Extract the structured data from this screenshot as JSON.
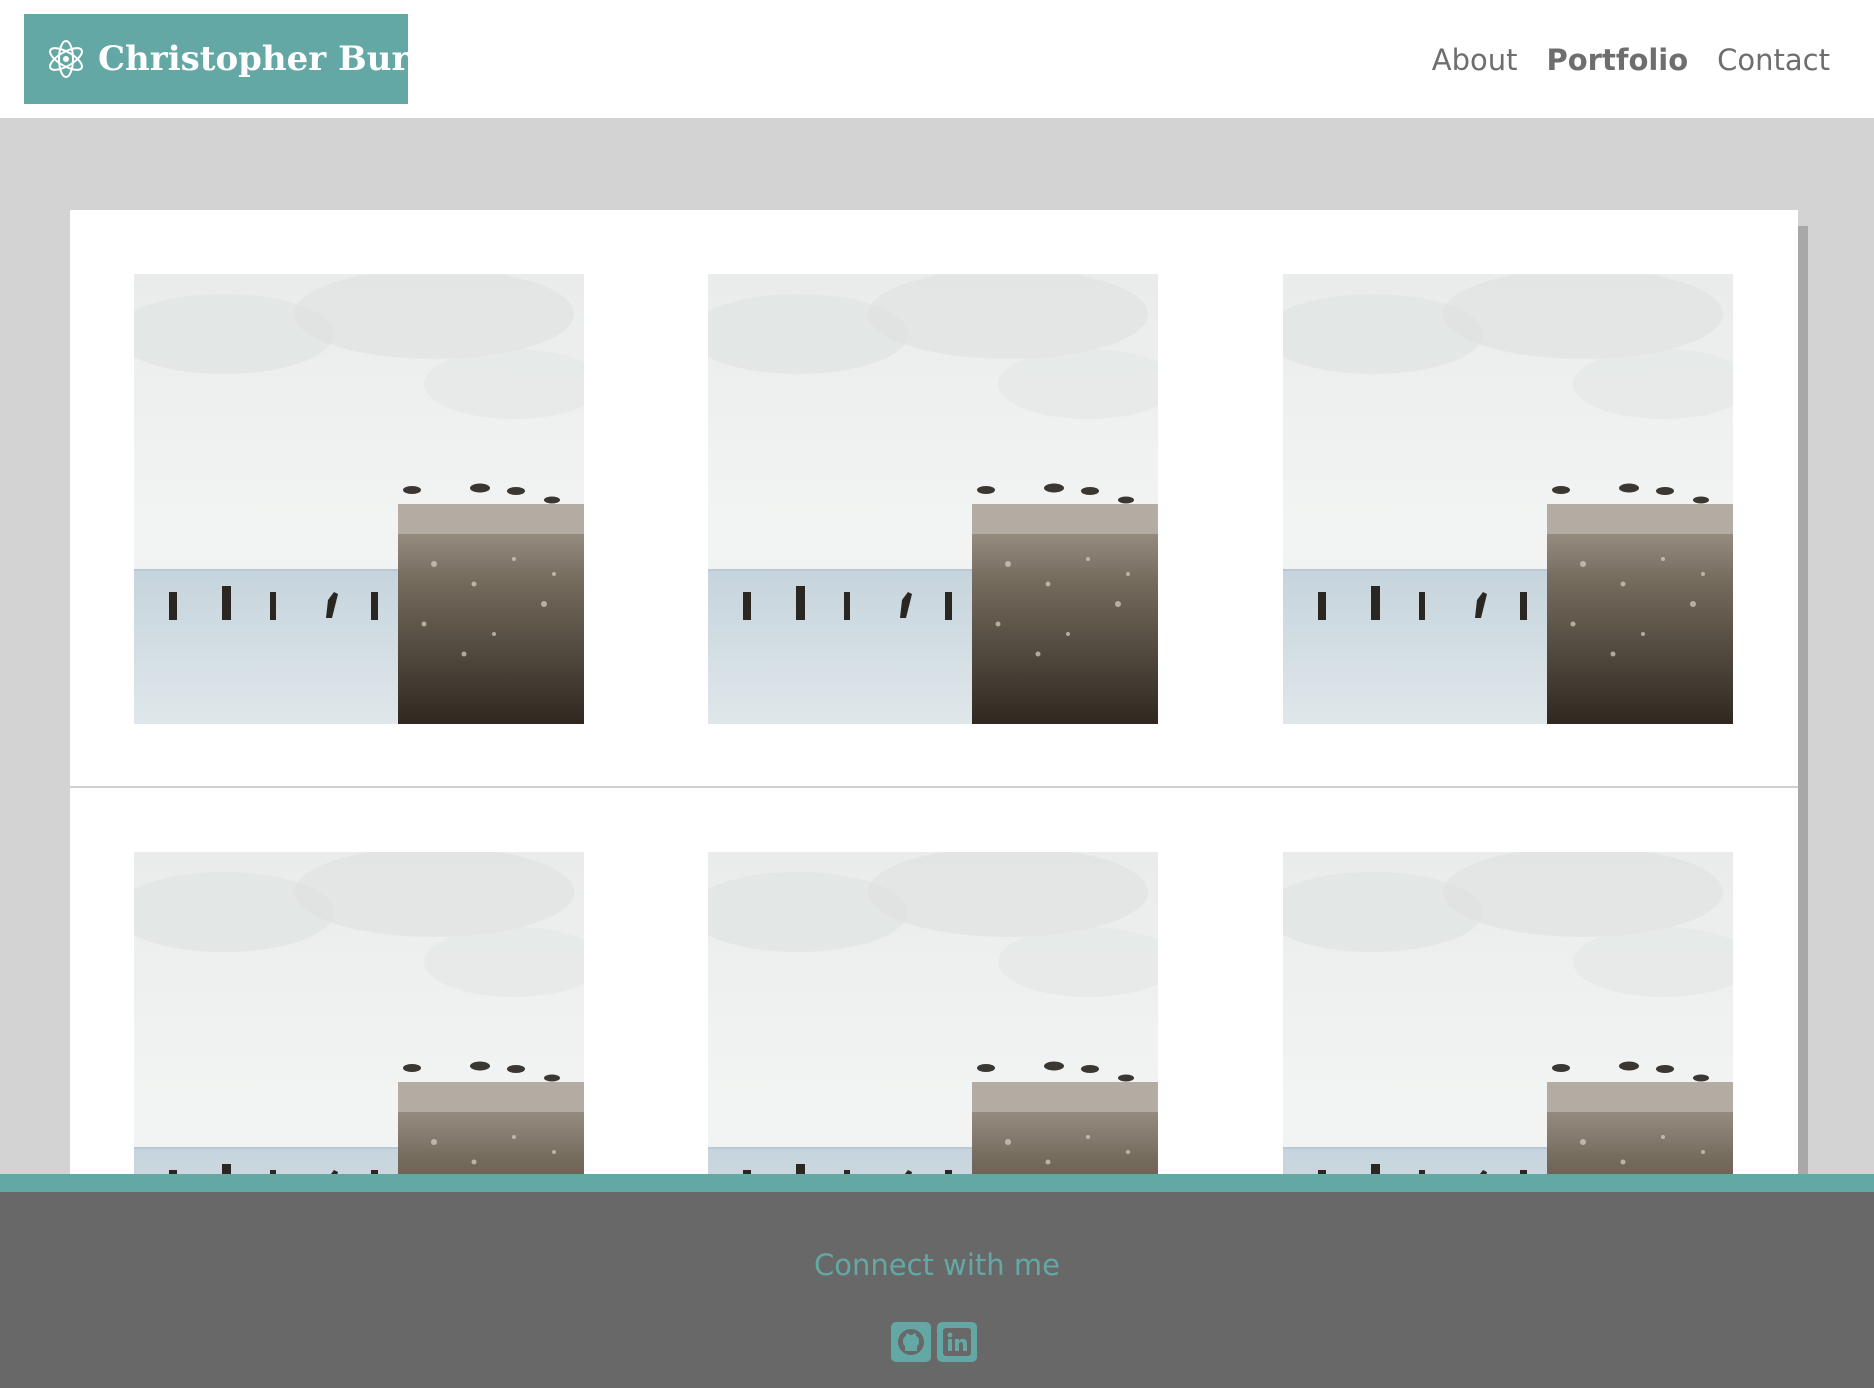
{
  "header": {
    "brand": "Christopher Burns",
    "nav": [
      {
        "label": "About",
        "active": false
      },
      {
        "label": "Portfolio",
        "active": true
      },
      {
        "label": "Contact",
        "active": false
      }
    ]
  },
  "gallery": {
    "rows": 2,
    "columns": 3,
    "photo_subject": "seagulls-on-concrete-pier"
  },
  "footer": {
    "title": "Connect with me",
    "icons": [
      "github-icon",
      "linkedin-icon"
    ]
  },
  "colors": {
    "accent": "#63a8a4",
    "page_bg": "#d3d3d3",
    "footer_bg": "#686868",
    "nav_text": "#6e6e6e"
  }
}
